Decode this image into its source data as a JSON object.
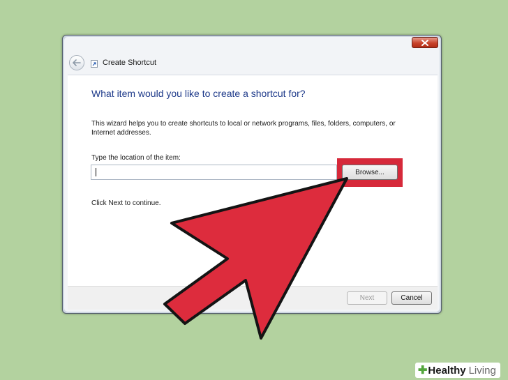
{
  "window": {
    "title": "Create Shortcut",
    "heading": "What item would you like to create a shortcut for?",
    "description": "This wizard helps you to create shortcuts to local or network programs, files, folders, computers, or Internet addresses.",
    "location_label": "Type the location of the item:",
    "location_value": "",
    "browse_label": "Browse...",
    "continue_text": "Click Next to continue.",
    "next_label": "Next",
    "cancel_label": "Cancel"
  },
  "icons": {
    "close": "close-icon",
    "back": "back-arrow-icon",
    "wizard": "shortcut-wizard-icon",
    "pointer": "red-pointer-arrow"
  },
  "colors": {
    "background": "#b3d29f",
    "heading": "#1e3a8a",
    "highlight": "#d6293a",
    "brand_green": "#54a63d"
  },
  "branding": {
    "part1": "Healthy",
    "part2": "Living"
  }
}
